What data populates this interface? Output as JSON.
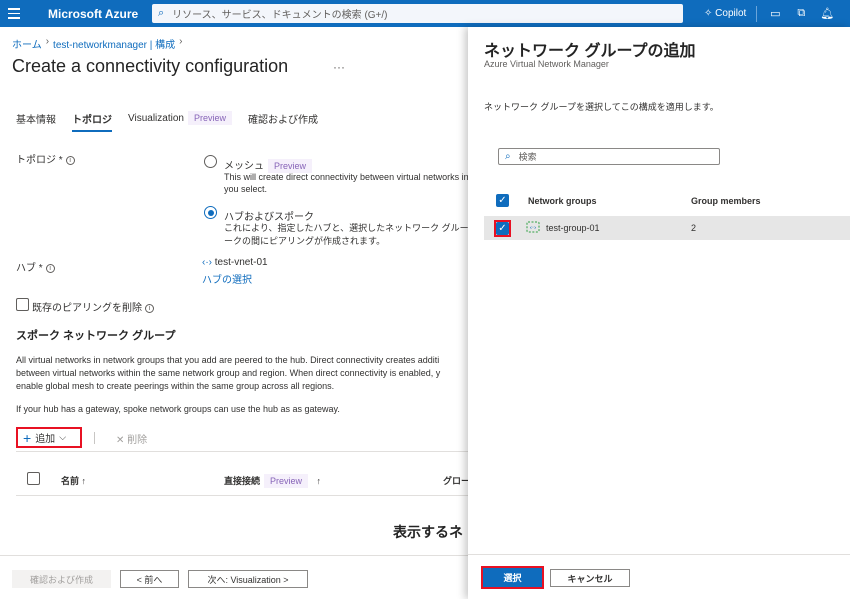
{
  "topbar": {
    "brand": "Microsoft Azure",
    "search_placeholder": "リソース、サービス、ドキュメントの検索 (G+/)",
    "copilot_label": "Copilot"
  },
  "breadcrumb": [
    "ホーム",
    "test-networkmanager | 構成"
  ],
  "page_title": "Create a connectivity configuration",
  "title_more": "···",
  "tabs": [
    {
      "label": "基本情報"
    },
    {
      "label": "トポロジ"
    },
    {
      "label": "Visualization",
      "badge": "Preview"
    },
    {
      "label": "確認および作成"
    }
  ],
  "topology": {
    "label": "トポロジ *",
    "options": [
      {
        "label": "メッシュ",
        "badge": "Preview",
        "desc1": "This will create direct connectivity between virtual networks in",
        "desc2": "you select."
      },
      {
        "label": "ハブおよびスポーク",
        "desc1": "これにより、指定したハブと、選択したネットワーク グループ",
        "desc2": "ークの間にピアリングが作成されます。"
      }
    ]
  },
  "hub": {
    "label": "ハブ *",
    "value": "test-vnet-01",
    "select_link": "ハブの選択"
  },
  "delete_peering_label": "既存のピアリングを削除",
  "spoke": {
    "title": "スポーク ネットワーク グループ",
    "para1": [
      "All virtual networks in network groups that you add are peered to the hub. Direct connectivity creates additi",
      "between virtual networks within the same network group and region. When direct connectivity is enabled, y",
      "enable global mesh to create peerings within the same group across all regions."
    ],
    "para2": "If your hub has a gateway, spoke network groups can use the hub as as gateway.",
    "add_label": "追加",
    "delete_label": "削除",
    "columns": {
      "name": "名前 ↑",
      "direct": "直接接続",
      "direct_badge": "Preview",
      "direct_sort": "↑",
      "global": "グロー"
    },
    "empty": "表示するネ"
  },
  "footer": {
    "review_create": "確認および作成",
    "prev": "< 前へ",
    "next": "次へ: Visualization >"
  },
  "panel": {
    "title": "ネットワーク グループの追加",
    "subtitle": "Azure Virtual Network Manager",
    "description": "ネットワーク グループを選択してこの構成を適用します。",
    "search_placeholder": "検索",
    "columns": {
      "groups": "Network groups",
      "members": "Group members"
    },
    "rows": [
      {
        "name": "test-group-01",
        "members": "2",
        "checked": true
      }
    ],
    "select_label": "選択",
    "cancel_label": "キャンセル"
  }
}
